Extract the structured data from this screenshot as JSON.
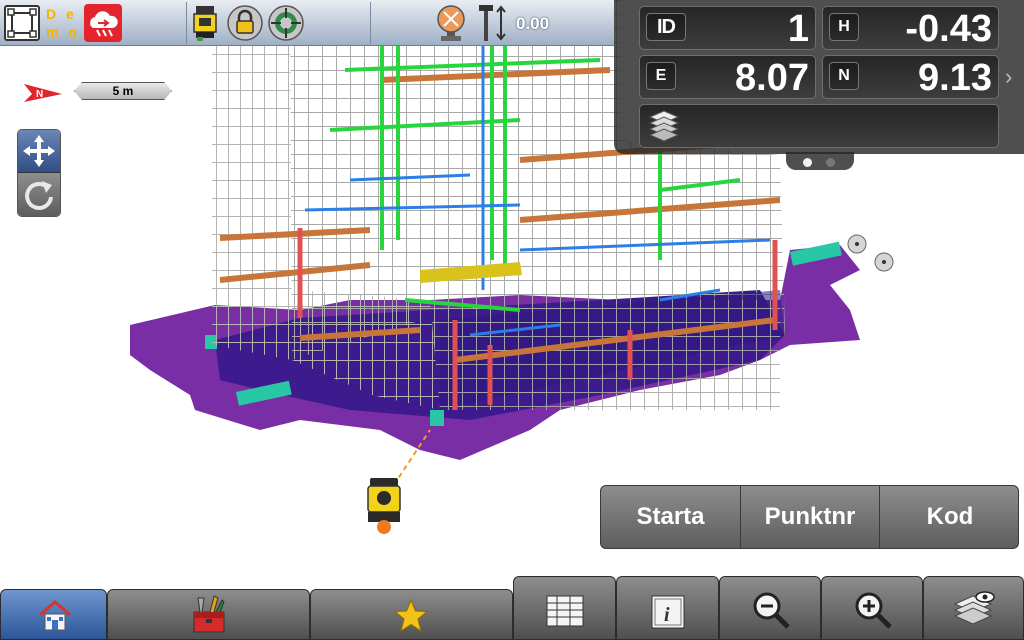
{
  "topbar": {
    "demo_line1": "D e",
    "demo_line2": "m o",
    "height_offset": "0.00",
    "icons": [
      "layout-icon",
      "cloud-sync-icon",
      "instrument-icon",
      "lock-icon",
      "target-icon",
      "prism-icon",
      "rod-height-icon"
    ]
  },
  "panel": {
    "id_label": "ID",
    "id_value": "1",
    "h_label": "H",
    "h_value": "-0.43",
    "e_label": "E",
    "e_value": "8.07",
    "n_label": "N",
    "n_value": "9.13",
    "layers_icon": "layers-icon",
    "page_count": 2,
    "active_page": 1
  },
  "map": {
    "scale_label": "5 m"
  },
  "actions": {
    "start_label": "Starta",
    "point_label": "Punktnr",
    "code_label": "Kod"
  },
  "bottombar": {
    "items": [
      "home-icon",
      "toolbox-icon",
      "favorites-icon",
      "table-icon",
      "info-icon",
      "zoom-out-icon",
      "zoom-in-icon",
      "layer-visibility-icon"
    ]
  },
  "colors": {
    "slab": "#7a2ea6",
    "frame": "#b8b8b8",
    "pipe_green": "#27d63c",
    "pipe_blue": "#2b7fe6",
    "beam_orange": "#c8753a",
    "column_red": "#e05252",
    "accent_red": "#e2242c",
    "panel_bg": "#2b2b2b"
  }
}
